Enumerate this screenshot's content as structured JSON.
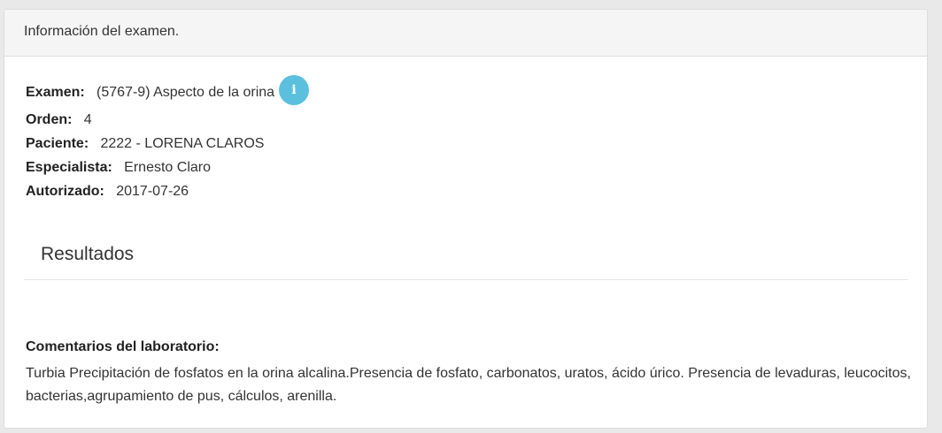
{
  "panel": {
    "heading": "Información del examen."
  },
  "exam": {
    "examen_label": "Examen:",
    "examen_value": "(5767-9) Aspecto de la orina",
    "orden_label": "Orden:",
    "orden_value": "4",
    "paciente_label": "Paciente:",
    "paciente_value": "2222 - LORENA CLAROS",
    "especialista_label": "Especialista:",
    "especialista_value": "Ernesto Claro",
    "autorizado_label": "Autorizado:",
    "autorizado_value": "2017-07-26",
    "info_icon_glyph": "i",
    "info_icon": "info-icon"
  },
  "results": {
    "title": "Resultados"
  },
  "comments": {
    "label": "Comentarios del laboratorio:",
    "text": "Turbia Precipitación de fosfatos en la orina alcalina.Presencia de fosfato, carbonatos, uratos, ácido úrico. Presencia de levaduras, leucocitos, bacterias,agrupamiento de pus, cálculos, arenilla."
  },
  "colors": {
    "info_accent": "#5bc0de",
    "panel_heading_bg": "#f5f5f5"
  }
}
